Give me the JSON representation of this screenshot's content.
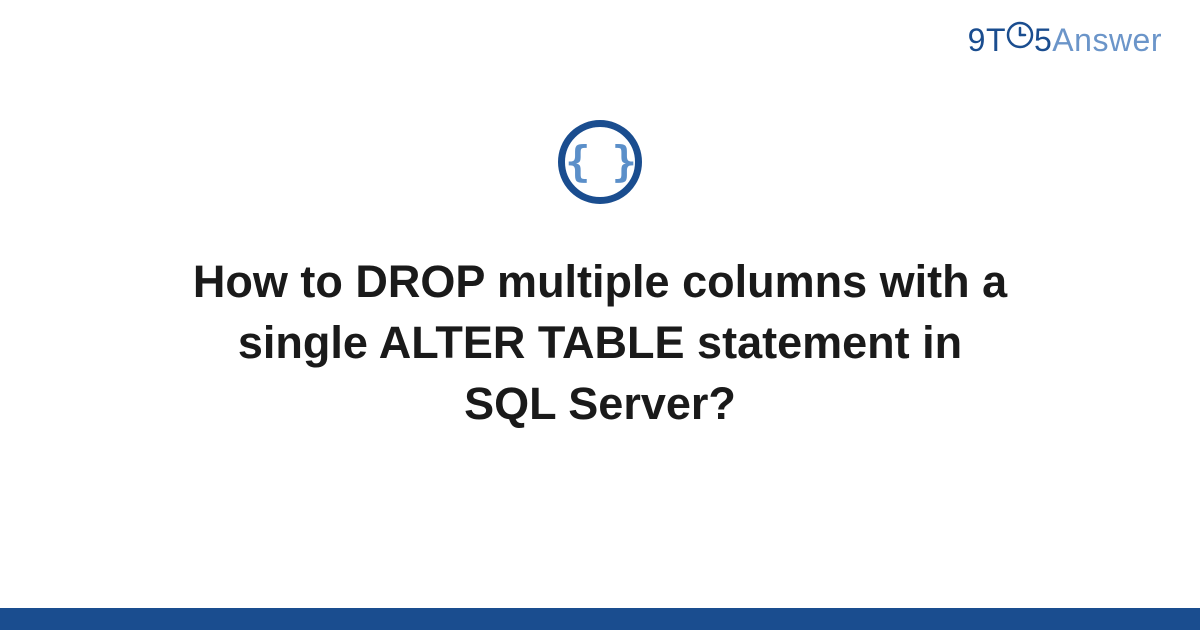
{
  "brand": {
    "part1": "9T",
    "part2": "5",
    "part3": "Answer"
  },
  "icon": {
    "symbol": "{ }",
    "name": "code-braces-icon"
  },
  "question": {
    "title": "How to DROP multiple columns with a single ALTER TABLE statement in SQL Server?"
  },
  "colors": {
    "primary": "#1a4d8f",
    "secondary": "#6b95c9",
    "iconFill": "#5b8fc9"
  }
}
